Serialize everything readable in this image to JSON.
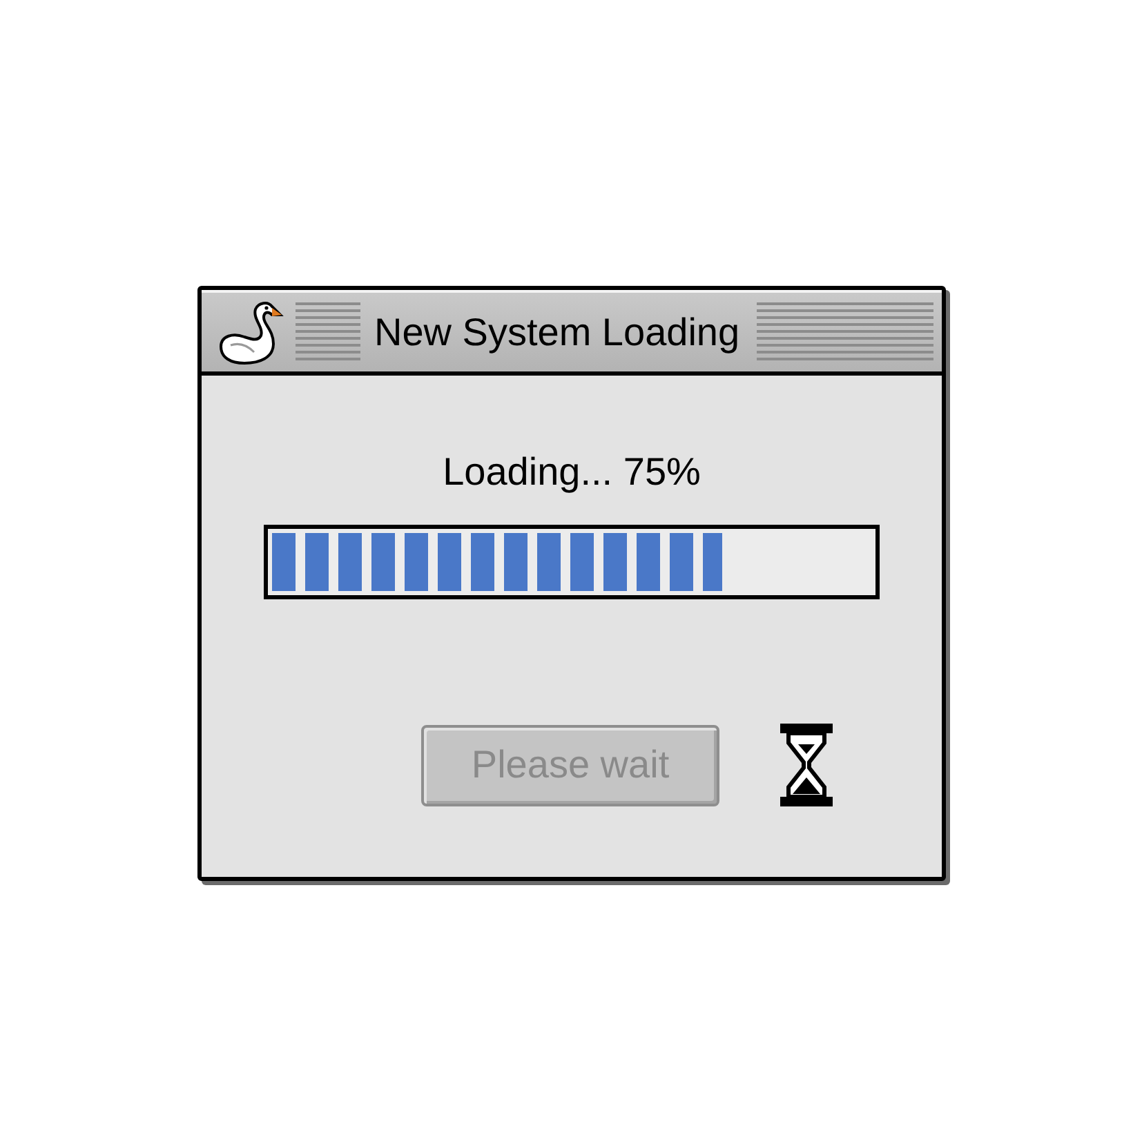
{
  "window": {
    "title": "New System Loading"
  },
  "status": {
    "text": "Loading... 75%"
  },
  "progress": {
    "level": 0.75
  },
  "button": {
    "label": "Please wait",
    "disabled": true
  }
}
